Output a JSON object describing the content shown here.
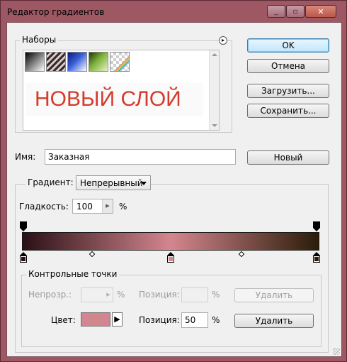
{
  "window": {
    "title": "Редактор градиентов",
    "close_glyph": "✕",
    "minimize_glyph": "_",
    "maximize_glyph": "▫"
  },
  "presets": {
    "label": "Наборы",
    "menu_glyph": "▸",
    "overlay_text": "НОВЫЙ СЛОЙ",
    "overlay_color": "#d33b2c",
    "swatch_icons": [
      "black-white-gradient-swatch",
      "striped-gradient-swatch",
      "blue-gradient-swatch",
      "green-gradient-swatch",
      "transparent-rainbow-gradient-swatch"
    ]
  },
  "buttons": {
    "ok": "OK",
    "cancel": "Отмена",
    "load": "Загрузить...",
    "save": "Сохранить...",
    "new": "Новый"
  },
  "name": {
    "label": "Имя:",
    "value": "Заказная"
  },
  "gradient": {
    "label": "Градиент:",
    "type_value": "Непрерывный",
    "smoothness_label": "Гладкость:",
    "smoothness_value": "100",
    "percent": "%",
    "colors": [
      "#2a1015",
      "#d4868f",
      "#2b1c08"
    ]
  },
  "stops": {
    "label": "Контрольные точки",
    "opacity_label": "Непрозр.:",
    "opacity_value": "",
    "location_label": "Позиция:",
    "location_value_disabled": "",
    "delete_label": "Удалить",
    "color_label": "Цвет:",
    "color_value": "#d4868f",
    "color_location_label": "Позиция:",
    "color_location_value": "50",
    "percent": "%",
    "arrow_glyph": "▶"
  }
}
